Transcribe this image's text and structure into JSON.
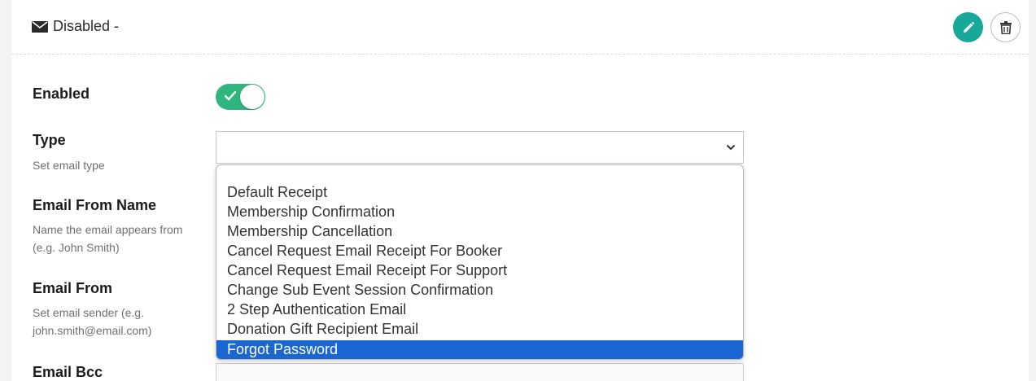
{
  "header": {
    "title": "Disabled -",
    "edit_icon": "pencil-icon",
    "delete_icon": "trash-icon",
    "accent": "#17a89a"
  },
  "fields": {
    "enabled": {
      "label": "Enabled",
      "toggle_on": true,
      "toggle_color": "#2fb57e"
    },
    "type": {
      "label": "Type",
      "help": "Set email type",
      "value": ""
    },
    "email_from_name": {
      "label": "Email From Name",
      "help_line1": "Name the email appears from",
      "help_line2": "(e.g. John Smith)"
    },
    "email_from": {
      "label": "Email From",
      "help_line1": "Set email sender (e.g.",
      "help_line2": "john.smith@email.com)"
    },
    "email_bcc": {
      "label": "Email Bcc"
    }
  },
  "dropdown": {
    "options": [
      "Default Receipt",
      "Membership Confirmation",
      "Membership Cancellation",
      "Cancel Request Email Receipt For Booker",
      "Cancel Request Email Receipt For Support",
      "Change Sub Event Session Confirmation",
      "2 Step Authentication Email",
      "Donation Gift Recipient Email",
      "Forgot Password"
    ],
    "highlighted": "Forgot Password",
    "highlight_color": "#1a66d2"
  }
}
